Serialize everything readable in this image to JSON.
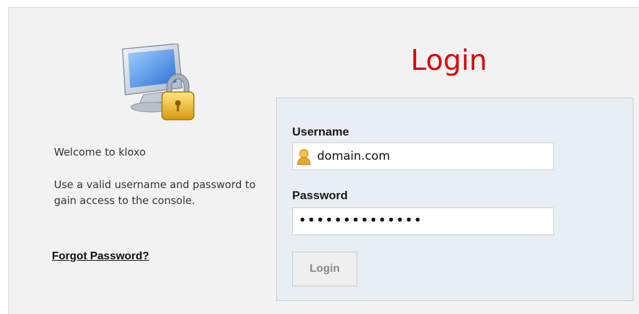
{
  "left": {
    "illustration_icon": "monitor-lock-icon",
    "welcome_text": "Welcome to kloxo",
    "instructions": "Use a valid username and password to gain access to the console.",
    "forgot_password": "Forgot Password?"
  },
  "form": {
    "title": "Login",
    "username_label": "Username",
    "username_value": "domain.com",
    "username_icon": "user-icon",
    "password_label": "Password",
    "password_masked": "••••••••••••••",
    "login_button": "Login"
  },
  "colors": {
    "title": "#dd0a0a",
    "form_background": "#e9eef4",
    "page_background": "#f2f2f2"
  }
}
